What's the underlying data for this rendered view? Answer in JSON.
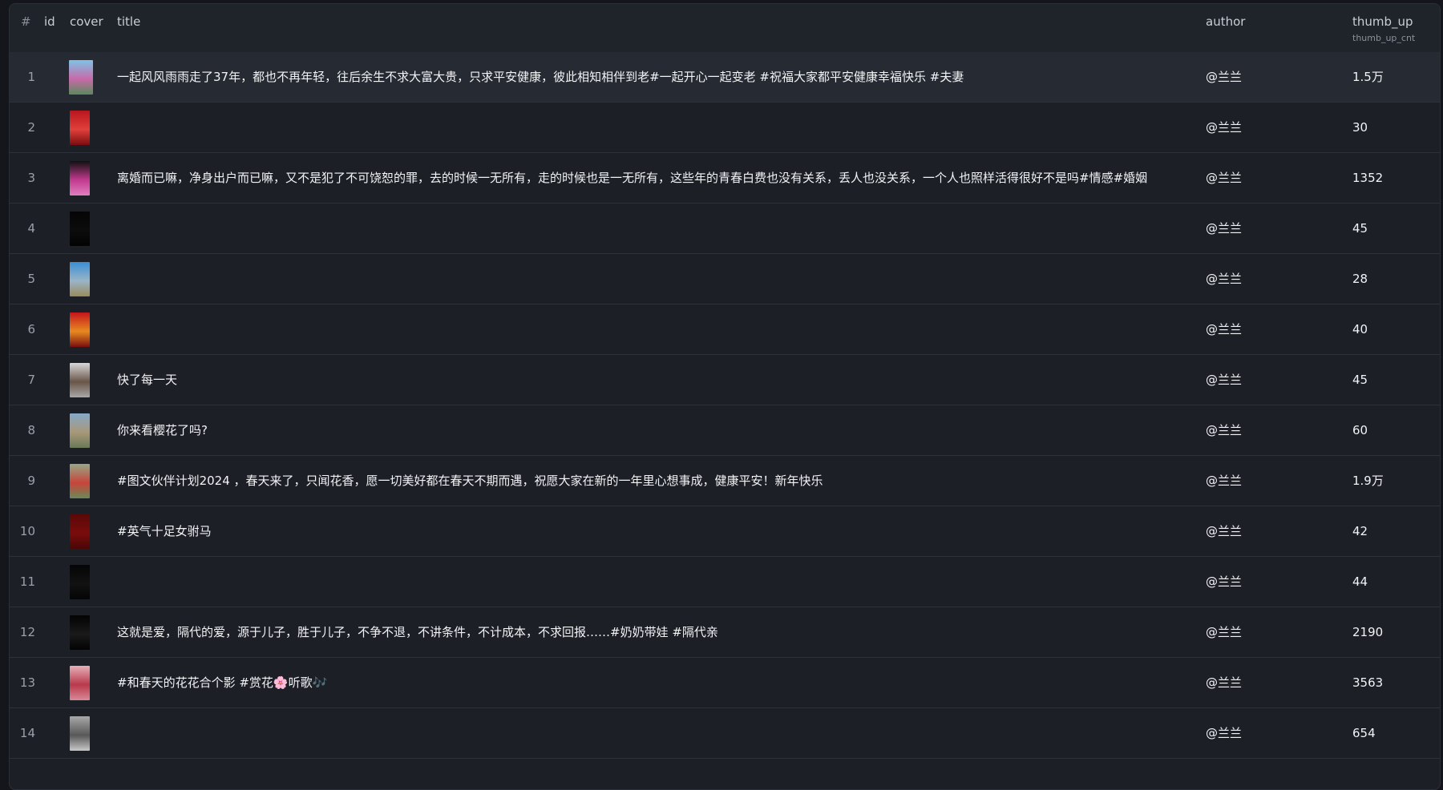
{
  "table": {
    "headers": {
      "num": "#",
      "id": "id",
      "cover": "cover",
      "title": "title",
      "author": "author",
      "thumb_up": "thumb_up",
      "thumb_up_sub": "thumb_up_cnt"
    },
    "rows": [
      {
        "num": "1",
        "title": "一起风风雨雨走了37年，都也不再年轻，往后余生不求大富大贵，只求平安健康，彼此相知相伴到老#一起开心一起变老 #祝福大家都平安健康幸福快乐 #夫妻",
        "author": "@兰兰",
        "thumb_up": "1.5万",
        "cover_colors": [
          "#7ec3e6",
          "#c86aa8",
          "#5a8a5c"
        ]
      },
      {
        "num": "2",
        "title": "",
        "author": "@兰兰",
        "thumb_up": "30",
        "cover_colors": [
          "#b8161e",
          "#e0403a",
          "#7a0c10"
        ]
      },
      {
        "num": "3",
        "title": "离婚而已嘛，净身出户而已嘛，又不是犯了不可饶恕的罪，去的时候一无所有，走的时候也是一无所有，这些年的青春白费也没有关系，丢人也没关系，一个人也照样活得很好不是吗#情感#婚姻",
        "author": "@兰兰",
        "thumb_up": "1352",
        "cover_colors": [
          "#111111",
          "#c23a8e",
          "#e07fc0"
        ]
      },
      {
        "num": "4",
        "title": "",
        "author": "@兰兰",
        "thumb_up": "45",
        "cover_colors": [
          "#050505",
          "#0c0c0c",
          "#030303"
        ]
      },
      {
        "num": "5",
        "title": "",
        "author": "@兰兰",
        "thumb_up": "28",
        "cover_colors": [
          "#3a8fd4",
          "#9ab4c8",
          "#9a8a5a"
        ]
      },
      {
        "num": "6",
        "title": "",
        "author": "@兰兰",
        "thumb_up": "40",
        "cover_colors": [
          "#c4141c",
          "#e88a20",
          "#7a1010"
        ]
      },
      {
        "num": "7",
        "title": "快了每一天",
        "author": "@兰兰",
        "thumb_up": "45",
        "cover_colors": [
          "#d8d8d8",
          "#6a5548",
          "#a8a8a8"
        ]
      },
      {
        "num": "8",
        "title": "你来看樱花了吗?",
        "author": "@兰兰",
        "thumb_up": "60",
        "cover_colors": [
          "#86a8c8",
          "#a89878",
          "#6a7a58"
        ]
      },
      {
        "num": "9",
        "title": "#图文伙伴计划2024 ，春天来了，只闻花香，愿一切美好都在春天不期而遇，祝愿大家在新的一年里心想事成，健康平安！新年快乐",
        "author": "@兰兰",
        "thumb_up": "1.9万",
        "cover_colors": [
          "#98a888",
          "#c8443a",
          "#6a8a58"
        ]
      },
      {
        "num": "10",
        "title": "#英气十足女驸马",
        "author": "@兰兰",
        "thumb_up": "42",
        "cover_colors": [
          "#5a0808",
          "#7a0c0c",
          "#4a0606"
        ]
      },
      {
        "num": "11",
        "title": "",
        "author": "@兰兰",
        "thumb_up": "44",
        "cover_colors": [
          "#050505",
          "#121212",
          "#050505"
        ]
      },
      {
        "num": "12",
        "title": "这就是爱，隔代的爱，源于儿子，胜于儿子，不争不退，不讲条件，不计成本，不求回报……#奶奶带娃 #隔代亲",
        "author": "@兰兰",
        "thumb_up": "2190",
        "cover_colors": [
          "#030303",
          "#1a1a1a",
          "#030303"
        ]
      },
      {
        "num": "13",
        "title": "#和春天的花花合个影 #赏花🌸听歌🎶",
        "author": "@兰兰",
        "thumb_up": "3563",
        "cover_colors": [
          "#e6b0b8",
          "#b8384a",
          "#d88a98"
        ]
      },
      {
        "num": "14",
        "title": "",
        "author": "@兰兰",
        "thumb_up": "654",
        "cover_colors": [
          "#a8a8a8",
          "#585858",
          "#c8c8c8"
        ]
      }
    ]
  }
}
